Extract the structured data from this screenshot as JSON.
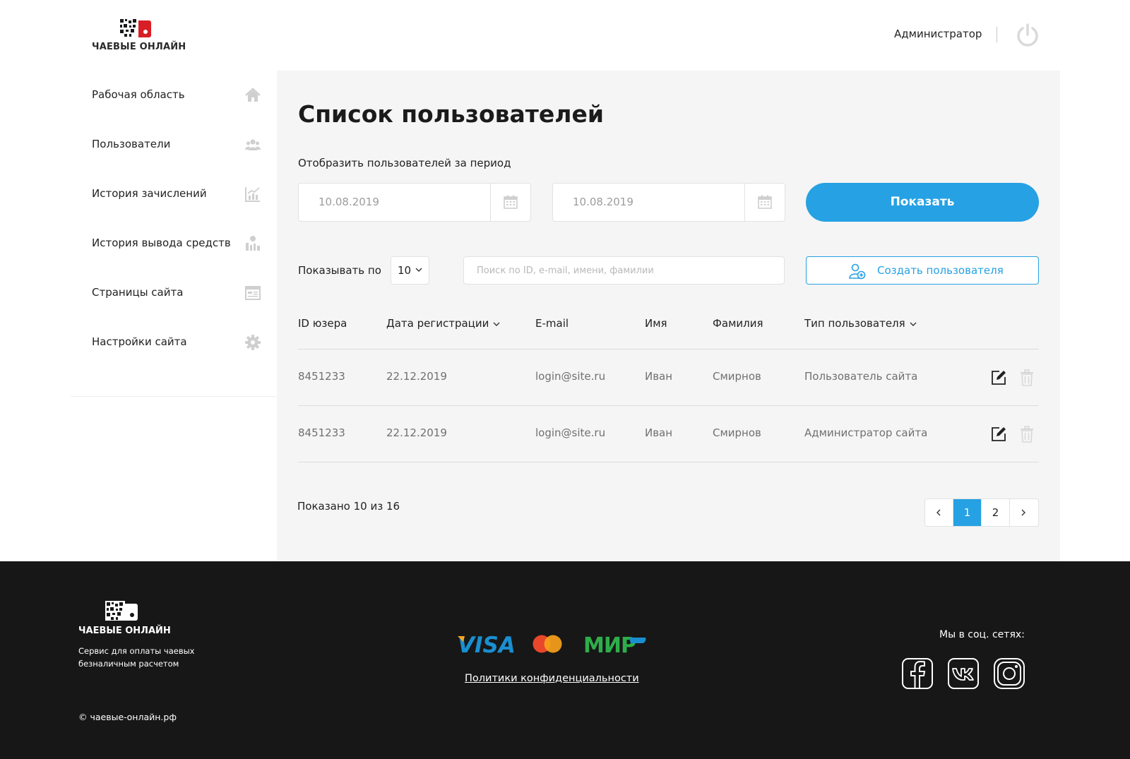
{
  "brand": {
    "name": "ЧАЕВЫЕ ОНЛАЙН"
  },
  "header": {
    "user_name": "Администратор"
  },
  "sidebar": {
    "items": [
      {
        "label": "Рабочая область",
        "icon": "home-icon"
      },
      {
        "label": "Пользователи",
        "icon": "users-icon"
      },
      {
        "label": "История зачислений",
        "icon": "chart-icon"
      },
      {
        "label": "История вывода средств",
        "icon": "money-stats-icon"
      },
      {
        "label": "Страницы сайта",
        "icon": "pages-icon"
      },
      {
        "label": "Настройки сайта",
        "icon": "gear-icon"
      }
    ]
  },
  "main": {
    "title": "Список пользователей",
    "period_label": "Отобразить пользователей за период",
    "date_from": "10.08.2019",
    "date_to": "10.08.2019",
    "show_button": "Показать",
    "per_page_label": "Показывать по",
    "per_page_value": "10",
    "search_placeholder": "Поиск по ID, e-mail, имени, фамилии",
    "create_button": "Создать пользователя"
  },
  "table": {
    "headers": {
      "id": "ID юзера",
      "reg_date": "Дата регистрации",
      "email": "E-mail",
      "first_name": "Имя",
      "last_name": "Фамилия",
      "user_type": "Тип пользователя"
    },
    "rows": [
      {
        "id": "8451233",
        "reg_date": "22.12.2019",
        "email": "login@site.ru",
        "first_name": "Иван",
        "last_name": "Смирнов",
        "user_type": "Пользователь сайта"
      },
      {
        "id": "8451233",
        "reg_date": "22.12.2019",
        "email": "login@site.ru",
        "first_name": "Иван",
        "last_name": "Смирнов",
        "user_type": "Администратор сайта"
      }
    ]
  },
  "pagination": {
    "shown_text": "Показано 10 из 16",
    "pages": [
      "1",
      "2"
    ],
    "current_page": "1"
  },
  "footer": {
    "brand": "ЧАЕВЫЕ ОНЛАЙН",
    "tagline": "Сервис для оплаты чаевых безналичным расчетом",
    "copyright": "© чаевые-онлайн.рф",
    "payment_logos": [
      "VISA",
      "mastercard",
      "МИР"
    ],
    "privacy_link": "Политики конфиденциальности",
    "social_label": "Мы в соц. сетях:",
    "social_icons": [
      "facebook-icon",
      "vk-icon",
      "instagram-icon"
    ]
  },
  "colors": {
    "accent": "#26a1e3",
    "footer_bg": "#171717",
    "content_bg": "#f5f5f5",
    "logo_red": "#d81f26"
  }
}
